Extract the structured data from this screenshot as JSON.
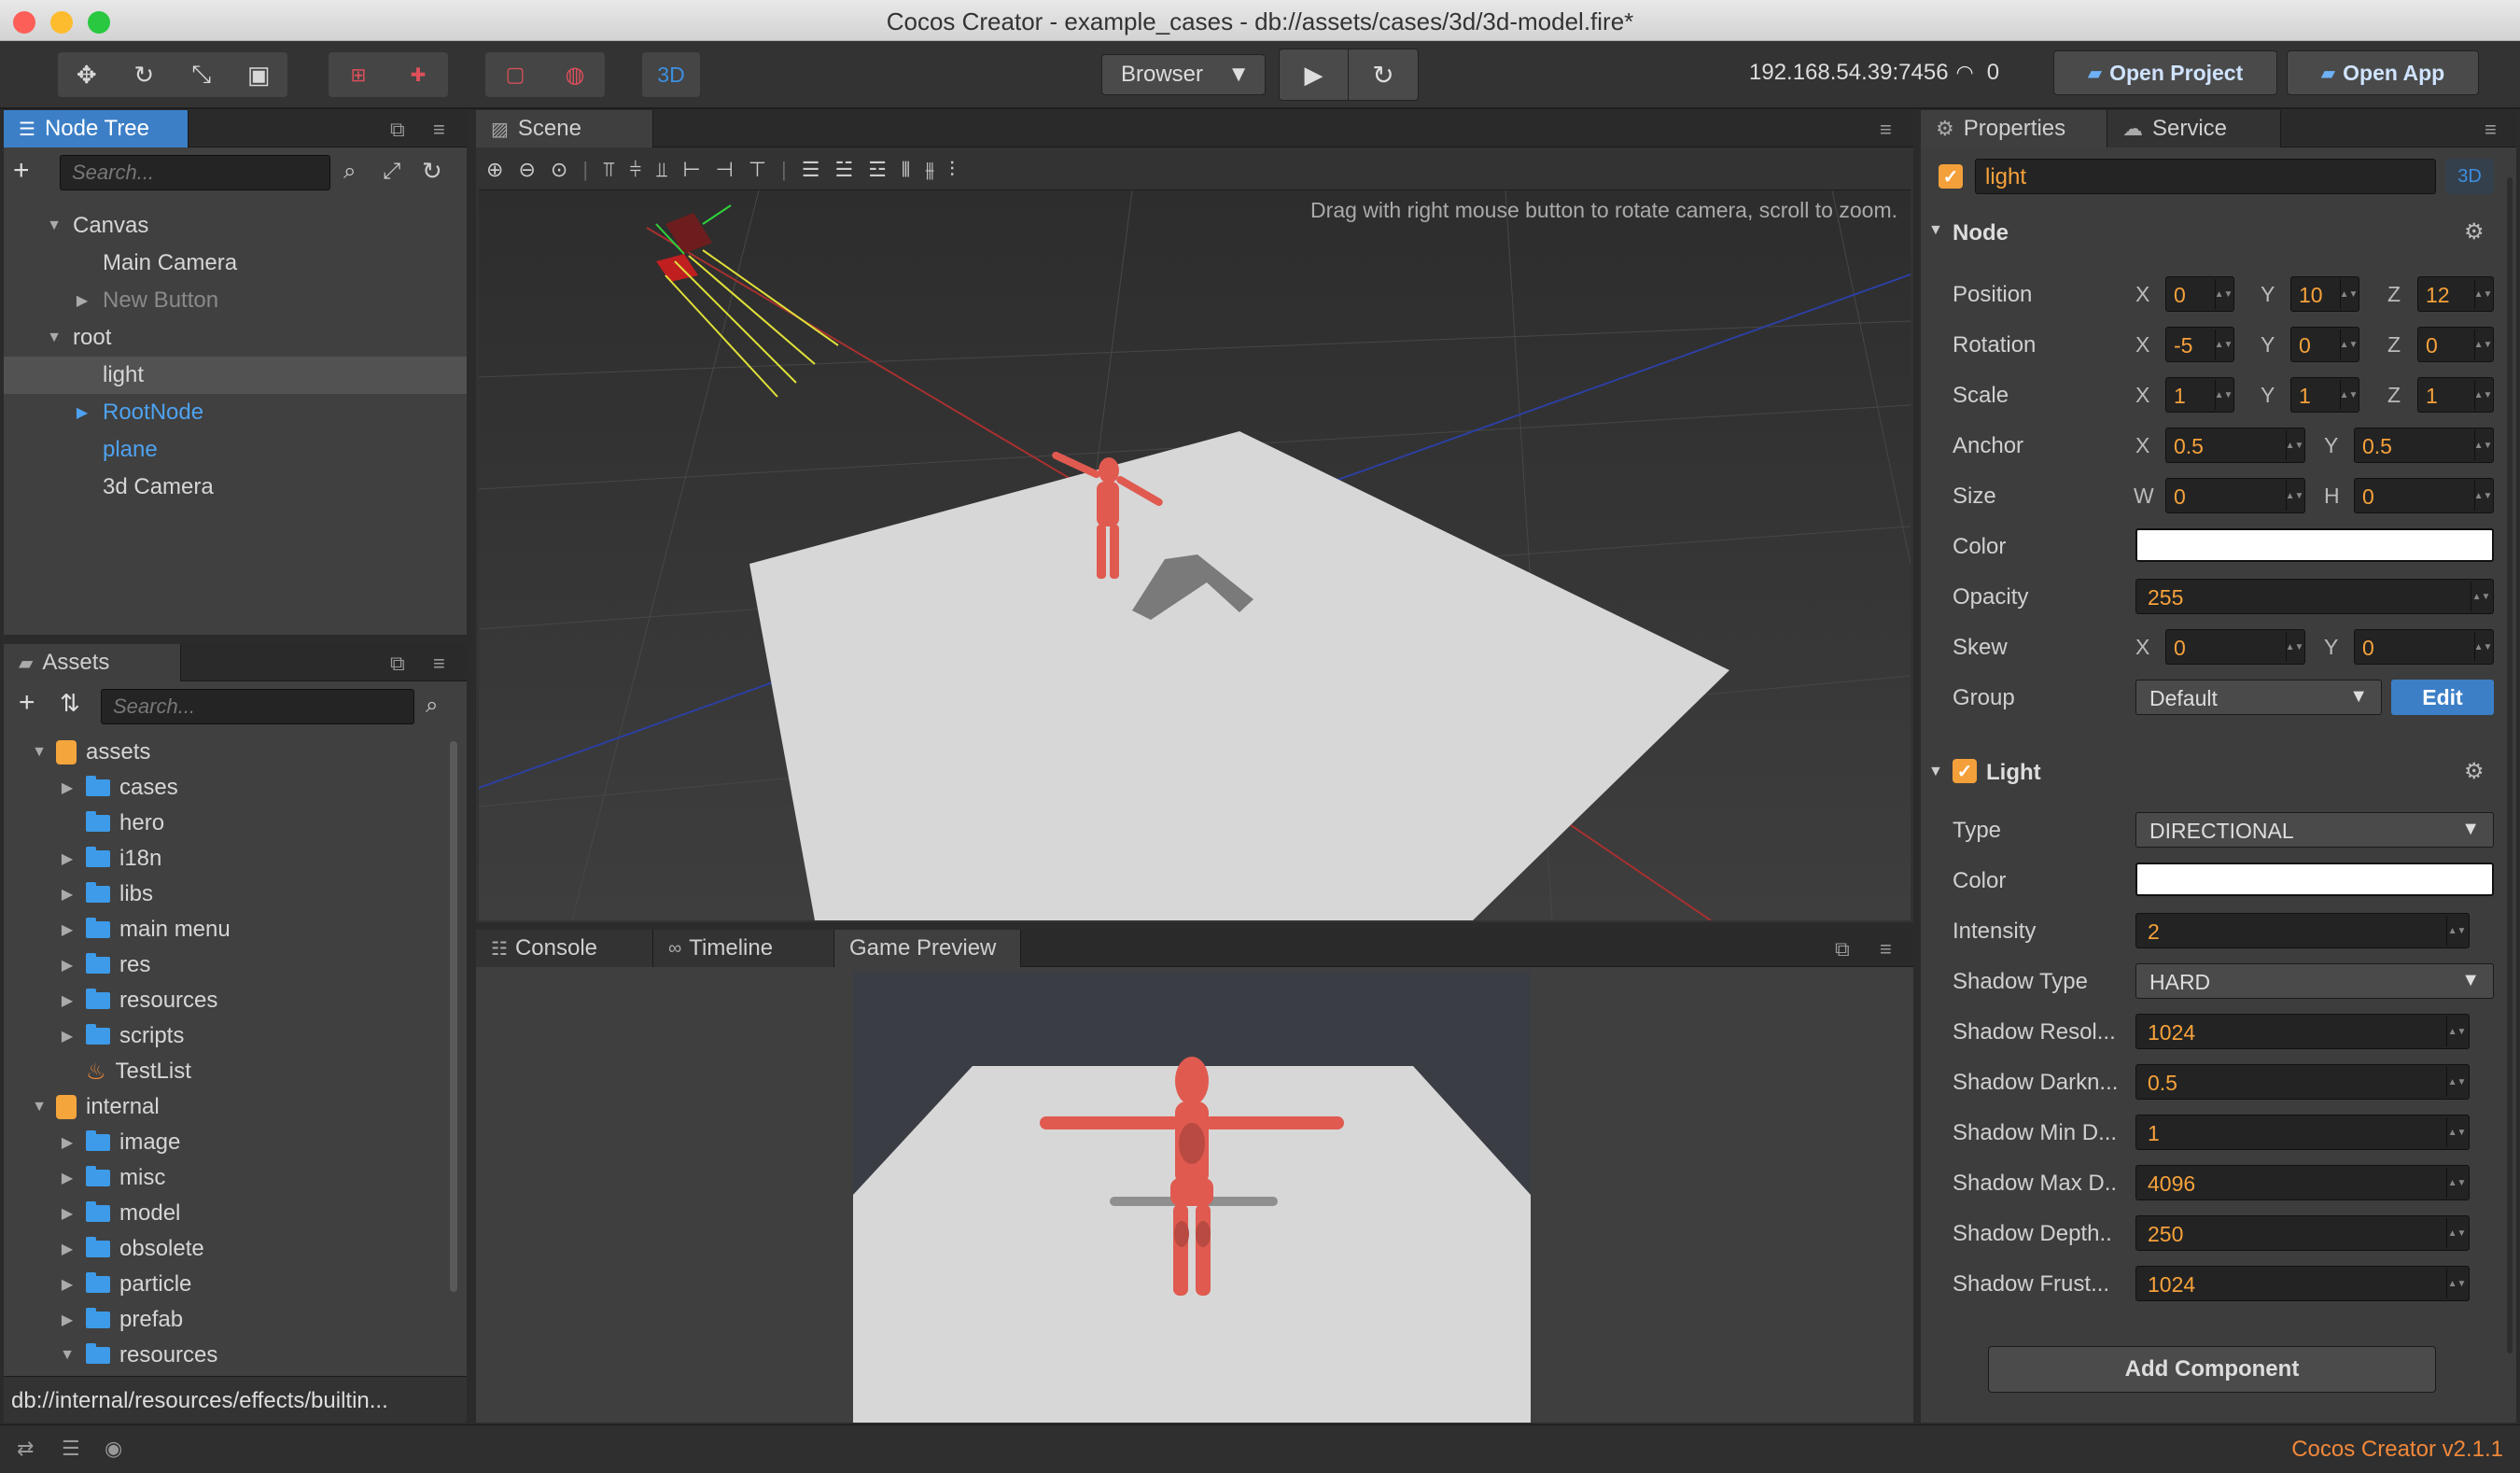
{
  "window": {
    "title": "Cocos Creator - example_cases - db://assets/cases/3d/3d-model.fire*"
  },
  "toolbar": {
    "mode_3d": "3D",
    "platform": "Browser",
    "ip": "192.168.54.39:7456",
    "device_count": "0",
    "open_project": "Open Project",
    "open_app": "Open App"
  },
  "node_tree": {
    "tab": "Node Tree",
    "search_placeholder": "Search...",
    "items": [
      {
        "label": "Canvas"
      },
      {
        "label": "Main Camera"
      },
      {
        "label": "New Button"
      },
      {
        "label": "root"
      },
      {
        "label": "light"
      },
      {
        "label": "RootNode"
      },
      {
        "label": "plane"
      },
      {
        "label": "3d Camera"
      }
    ]
  },
  "assets": {
    "tab": "Assets",
    "search_placeholder": "Search...",
    "items": [
      {
        "label": "assets"
      },
      {
        "label": "cases"
      },
      {
        "label": "hero"
      },
      {
        "label": "i18n"
      },
      {
        "label": "libs"
      },
      {
        "label": "main menu"
      },
      {
        "label": "res"
      },
      {
        "label": "resources"
      },
      {
        "label": "scripts"
      },
      {
        "label": "TestList"
      },
      {
        "label": "internal"
      },
      {
        "label": "image"
      },
      {
        "label": "misc"
      },
      {
        "label": "model"
      },
      {
        "label": "obsolete"
      },
      {
        "label": "particle"
      },
      {
        "label": "prefab"
      },
      {
        "label": "resources"
      }
    ],
    "path": "db://internal/resources/effects/builtin..."
  },
  "scene": {
    "tab": "Scene",
    "hint": "Drag with right mouse button to rotate camera, scroll to zoom."
  },
  "bottom_tabs": {
    "console": "Console",
    "timeline": "Timeline",
    "game_preview": "Game Preview"
  },
  "properties": {
    "tab": "Properties",
    "service_tab": "Service",
    "node_name": "light",
    "badge_3d": "3D",
    "node_section": "Node",
    "position_label": "Position",
    "position": {
      "x": "0",
      "y": "10",
      "z": "12"
    },
    "rotation_label": "Rotation",
    "rotation": {
      "x": "-5",
      "y": "0",
      "z": "0"
    },
    "scale_label": "Scale",
    "scale": {
      "x": "1",
      "y": "1",
      "z": "1"
    },
    "anchor_label": "Anchor",
    "anchor": {
      "x": "0.5",
      "y": "0.5"
    },
    "size_label": "Size",
    "size": {
      "w": "0",
      "h": "0"
    },
    "color_label": "Color",
    "opacity_label": "Opacity",
    "opacity": "255",
    "skew_label": "Skew",
    "skew": {
      "x": "0",
      "y": "0"
    },
    "group_label": "Group",
    "group": "Default",
    "edit": "Edit",
    "light_section": "Light",
    "type_label": "Type",
    "type": "DIRECTIONAL",
    "light_color_label": "Color",
    "intensity_label": "Intensity",
    "intensity": "2",
    "shadow_type_label": "Shadow Type",
    "shadow_type": "HARD",
    "shadow_resolution_label": "Shadow Resol...",
    "shadow_resolution": "1024",
    "shadow_darkness_label": "Shadow Darkn...",
    "shadow_darkness": "0.5",
    "shadow_min_label": "Shadow Min D...",
    "shadow_min": "1",
    "shadow_max_label": "Shadow Max D..",
    "shadow_max": "4096",
    "shadow_depth_label": "Shadow Depth..",
    "shadow_depth": "250",
    "shadow_frustum_label": "Shadow Frust...",
    "shadow_frustum": "1024",
    "add_component": "Add Component"
  },
  "axis": {
    "x": "X",
    "y": "Y",
    "z": "Z",
    "w": "W",
    "h": "H"
  },
  "status": {
    "version": "Cocos Creator v2.1.1"
  },
  "colors": {
    "accent": "#3c7fc7",
    "orange": "#f7a23b",
    "node_blue": "#4ea2f0"
  }
}
